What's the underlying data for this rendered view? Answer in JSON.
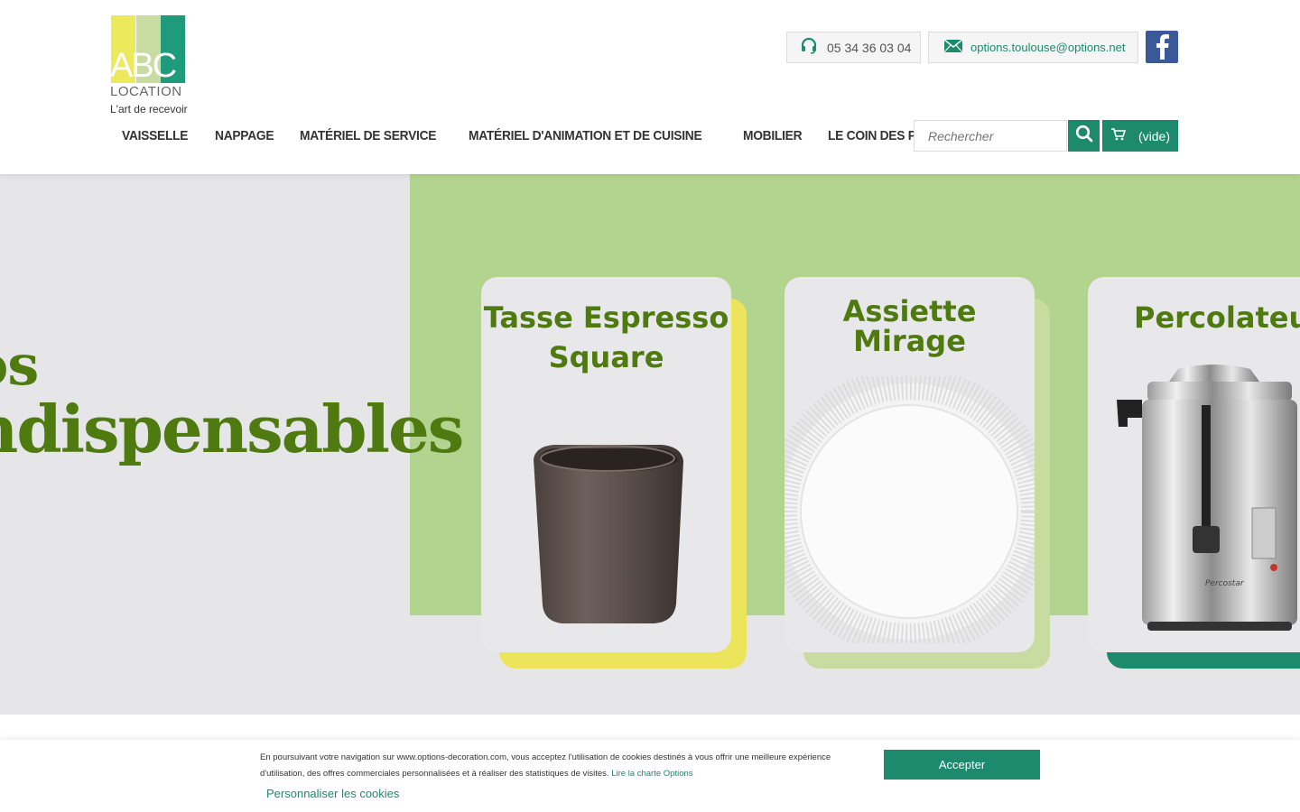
{
  "logo": {
    "letters": "ABC",
    "name": "LOCATION",
    "tagline": "L'art de recevoir"
  },
  "contact": {
    "phone": "05 34 36 03 04",
    "email": "options.toulouse@options.net"
  },
  "nav": [
    "VAISSELLE",
    "NAPPAGE",
    "MATÉRIEL DE SERVICE",
    "MATÉRIEL D'ANIMATION ET DE CUISINE",
    "MOBILIER",
    "LE COIN DES PROS"
  ],
  "search": {
    "placeholder": "Rechercher"
  },
  "cart": {
    "label": "(vide)"
  },
  "hero": {
    "title_line1": "os",
    "title_line2": "ndispensables",
    "products": [
      {
        "title_line1": "Tasse Espresso",
        "title_line2": "Square"
      },
      {
        "title_line1": "Assiette",
        "title_line2": "Mirage"
      },
      {
        "title_line1": "Percolateur",
        "title_line2": "",
        "brand": "Percostar"
      }
    ]
  },
  "cookie": {
    "text": "En poursuivant votre navigation sur www.options-decoration.com, vous acceptez l'utilisation de cookies destinés à vous offrir une meilleure expérience d'utilisation, des offres commerciales personnalisées et à réaliser des statistiques de visites.",
    "link": "Lire la charte Options",
    "customize": "Personnaliser les cookies",
    "accept": "Accepter"
  },
  "colors": {
    "brand_green": "#1e8a6d",
    "hero_green": "#b3d48f",
    "title_green": "#4e7a10",
    "logo_yellow": "#ece95a"
  }
}
